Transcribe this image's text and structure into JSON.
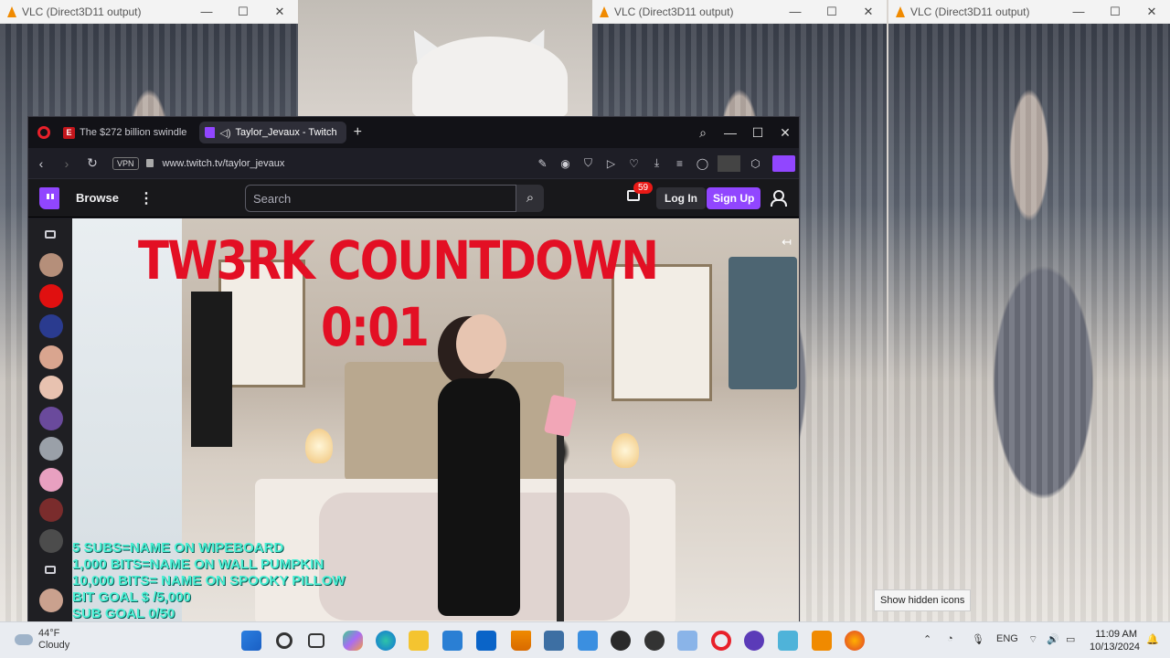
{
  "vlc_windows": [
    {
      "title": "VLC (Direct3D11 output)"
    },
    {
      "title": "VLC (Direct3D11 output)"
    },
    {
      "title": "VLC (Direct3D11 output)"
    }
  ],
  "browser": {
    "tabs": [
      {
        "label": "The $272 billion swindle",
        "active": false
      },
      {
        "label": "Taylor_Jevaux - Twitch",
        "active": true
      }
    ],
    "new_tab": "+",
    "vpn": "VPN",
    "url": "www.twitch.tv/taylor_jevaux"
  },
  "twitch": {
    "browse": "Browse",
    "search_placeholder": "Search",
    "notification_count": "59",
    "login": "Log In",
    "signup": "Sign Up"
  },
  "stream": {
    "title_line1": "TW3RK COUNTDOWN",
    "title_line2": "0:01",
    "goals": [
      "5 SUBS=NAME ON WIPEBOARD",
      "1,000 BITS=NAME ON WALL PUMPKIN",
      "10,000 BITS= NAME ON SPOOKY PILLOW",
      "BIT GOAL $ /5,000",
      "SUB GOAL 0/50"
    ]
  },
  "tooltip": "Show hidden icons",
  "taskbar": {
    "weather_temp": "44°F",
    "weather_desc": "Cloudy",
    "language": "ENG",
    "time": "11:09 AM",
    "date": "10/13/2024"
  }
}
